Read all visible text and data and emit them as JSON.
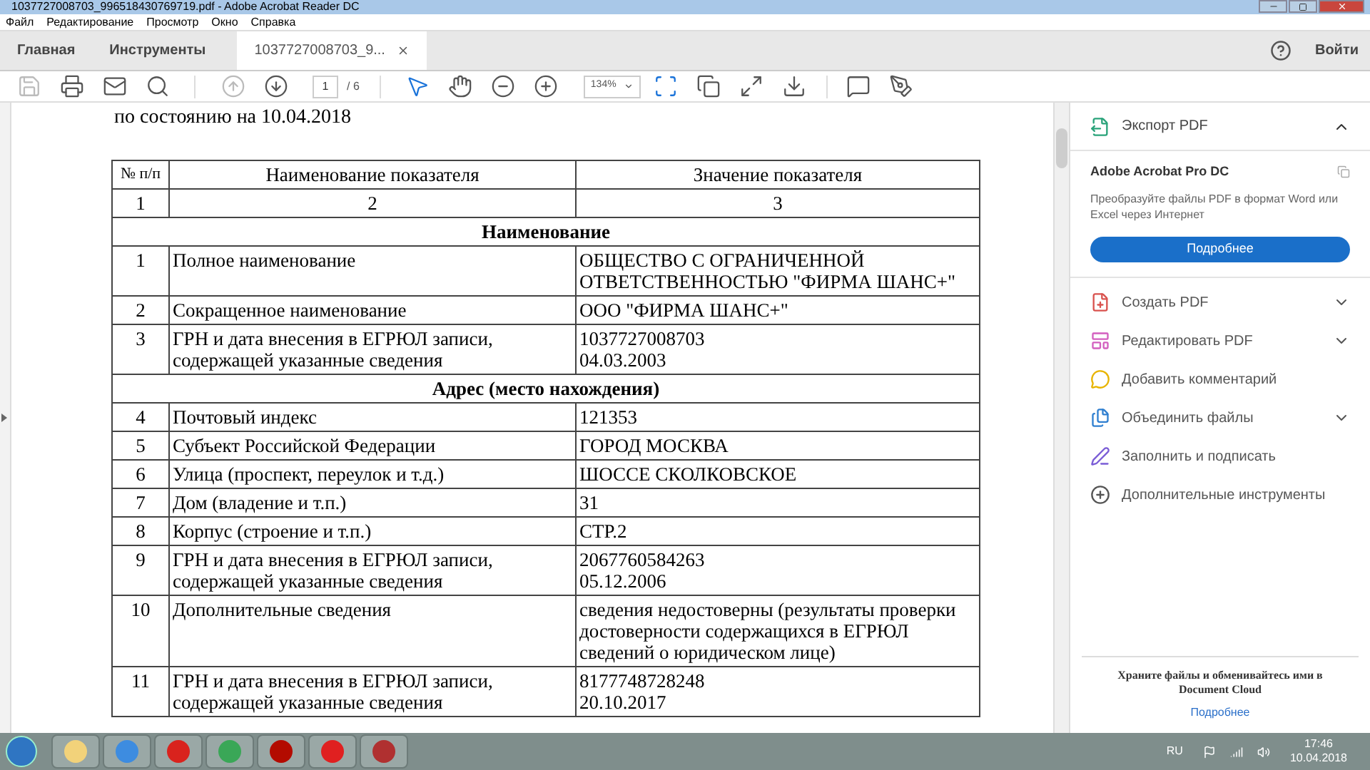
{
  "window": {
    "title": "1037727008703_996518430769719.pdf - Adobe Acrobat Reader DC"
  },
  "menu": [
    "Файл",
    "Редактирование",
    "Просмотр",
    "Окно",
    "Справка"
  ],
  "tabs": [
    {
      "label": "Главная",
      "selected": false
    },
    {
      "label": "Инструменты",
      "selected": false
    },
    {
      "label": "1037727008703_9...",
      "selected": true,
      "closable": true
    }
  ],
  "sign_in": "Войти",
  "toolbar": {
    "page_value": "1",
    "page_total": "/ 6",
    "zoom": "134%"
  },
  "document": {
    "subtitle": "по состоянию на 10.04.2018",
    "columns": [
      "№ п/п",
      "Наименование показателя",
      "Значение показателя"
    ],
    "rows": [
      {
        "kind": "numbering",
        "cells": [
          "1",
          "2",
          "3"
        ]
      },
      {
        "kind": "section",
        "title": "Наименование"
      },
      {
        "kind": "item",
        "cells": [
          "1",
          "Полное наименование",
          "ОБЩЕСТВО С ОГРАНИЧЕННОЙ ОТВЕТСТВЕННОСТЬЮ \"ФИРМА ШАНС+\""
        ]
      },
      {
        "kind": "item",
        "cells": [
          "2",
          "Сокращенное наименование",
          "ООО \"ФИРМА ШАНС+\""
        ]
      },
      {
        "kind": "item",
        "cells": [
          "3",
          "ГРН и дата внесения в ЕГРЮЛ записи, содержащей указанные сведения",
          "1037727008703\n04.03.2003"
        ]
      },
      {
        "kind": "section",
        "title": "Адрес (место нахождения)"
      },
      {
        "kind": "item",
        "cells": [
          "4",
          "Почтовый индекс",
          "121353"
        ]
      },
      {
        "kind": "item",
        "cells": [
          "5",
          "Субъект Российской Федерации",
          "ГОРОД МОСКВА"
        ]
      },
      {
        "kind": "item",
        "cells": [
          "6",
          "Улица (проспект, переулок и т.д.)",
          "ШОССЕ СКОЛКОВСКОЕ"
        ]
      },
      {
        "kind": "item",
        "cells": [
          "7",
          "Дом (владение и т.п.)",
          "31"
        ]
      },
      {
        "kind": "item",
        "cells": [
          "8",
          "Корпус (строение и т.п.)",
          "СТР.2"
        ]
      },
      {
        "kind": "item",
        "cells": [
          "9",
          "ГРН и дата внесения в ЕГРЮЛ записи, содержащей указанные сведения",
          "2067760584263\n05.12.2006"
        ]
      },
      {
        "kind": "item",
        "cells": [
          "10",
          "Дополнительные сведения",
          "сведения недостоверны (результаты проверки достоверности содержащихся в ЕГРЮЛ сведений о юридическом лице)"
        ]
      },
      {
        "kind": "item",
        "cells": [
          "11",
          "ГРН и дата внесения в ЕГРЮЛ записи, содержащей указанные сведения",
          "8177748728248\n20.10.2017"
        ]
      }
    ]
  },
  "panel": {
    "export": {
      "label": "Экспорт PDF",
      "expanded": true
    },
    "promo": {
      "title": "Adobe Acrobat Pro DC",
      "text": "Преобразуйте файлы PDF в формат Word или Excel через Интернет",
      "button": "Подробнее"
    },
    "tools": [
      {
        "kind": "create",
        "label": "Создать PDF",
        "has_menu": true
      },
      {
        "kind": "edit",
        "label": "Редактировать PDF",
        "has_menu": true
      },
      {
        "kind": "comment",
        "label": "Добавить комментарий",
        "has_menu": false
      },
      {
        "kind": "combine",
        "label": "Объединить файлы",
        "has_menu": true
      },
      {
        "kind": "sign",
        "label": "Заполнить и подписать",
        "has_menu": false
      },
      {
        "kind": "more",
        "label": "Дополнительные инструменты",
        "has_menu": false
      }
    ],
    "cloud": {
      "text": "Храните файлы и обменивайтесь ими в Document Cloud",
      "link": "Подробнее"
    }
  },
  "taskbar": {
    "language": "RU",
    "time": "17:46",
    "date": "10.04.2018"
  }
}
